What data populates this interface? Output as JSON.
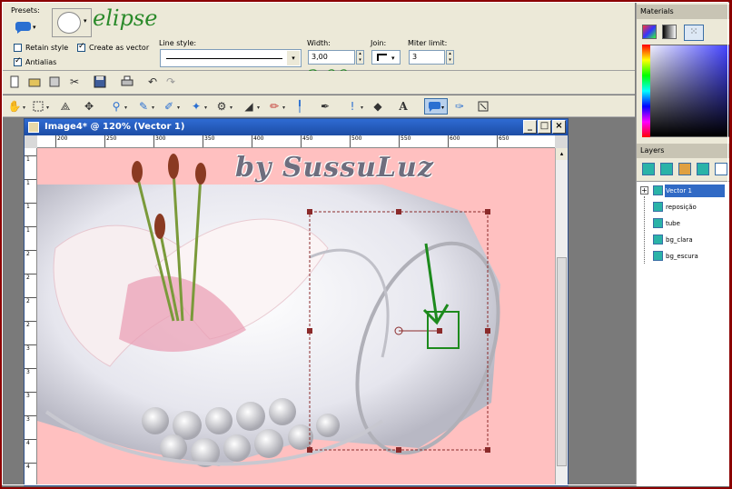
{
  "tool_options": {
    "presets_label": "Presets:",
    "shape_label": "elipse",
    "retain_style_label": "Retain style",
    "retain_style_checked": false,
    "create_as_vector_label": "Create as vector",
    "create_as_vector_checked": true,
    "antialias_label": "Antialias",
    "antialias_checked": true,
    "line_style_label": "Line style:",
    "width_label": "Width:",
    "width_value": "3,00",
    "width_annotation": "3,00",
    "join_label": "Join:",
    "miter_limit_label": "Miter limit:",
    "miter_limit_value": "3"
  },
  "toolbar": {
    "active_tool": "preset-shape"
  },
  "image_window": {
    "title": "Image4* @ 120% (Vector 1)",
    "ruler_h_ticks": [
      "200",
      "250",
      "300",
      "350",
      "400",
      "450",
      "500",
      "550",
      "600",
      "650"
    ],
    "ruler_v_ticks": [
      "1",
      "1",
      "1",
      "1",
      "2",
      "2",
      "2",
      "2",
      "3",
      "3",
      "3",
      "3",
      "4",
      "4"
    ]
  },
  "canvas": {
    "watermark": "by SussuLuz",
    "background_color": "#ffc0c0"
  },
  "materials": {
    "title": "Materials"
  },
  "layers": {
    "title": "Layers",
    "items": [
      {
        "name": "Vector 1",
        "selected": true
      },
      {
        "name": "reposição",
        "selected": false
      },
      {
        "name": "tube",
        "selected": false
      },
      {
        "name": "bg_clara",
        "selected": false
      },
      {
        "name": "bg_escura",
        "selected": false
      }
    ]
  },
  "colors": {
    "frame": "#8b0000",
    "titlebar": "#2f6bd3",
    "panel": "#ece9d8",
    "annotation": "#1d8a1d"
  }
}
